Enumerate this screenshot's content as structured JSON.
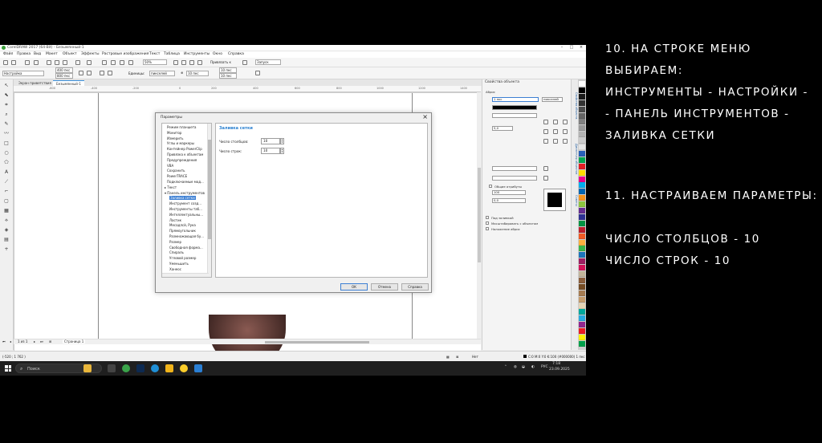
{
  "app": {
    "title": "CorelDRAW 2017 (64-Bit) - Безымянный-1",
    "menu": [
      "Файл",
      "Правка",
      "Вид",
      "Макет",
      "Объект",
      "Эффекты",
      "Растровые изображения",
      "Текст",
      "Таблица",
      "Инструменты",
      "Окно",
      "Справка"
    ],
    "std": {
      "zoom": "50%",
      "snap": "Привязать к",
      "launch": "Запуск"
    },
    "prop": {
      "preset": "Настройка",
      "w": "400 пкс",
      "h": "800 пкс",
      "units_label": "Единицы:",
      "units": "пикселей",
      "nudge": "10 пкс",
      "dup_x": "10 пкс",
      "dup_y": "10 пкс"
    },
    "tabs": [
      "Экран приветствия",
      "Безымянный-1"
    ],
    "ruler": [
      "-600",
      "-400",
      "-200",
      "0",
      "200",
      "400",
      "600",
      "800",
      "1000",
      "1200",
      "1400"
    ],
    "page_nav": {
      "counter": "1 из 1",
      "page": "Страница 1"
    },
    "status": {
      "coords": "(-520 ; 1 762 )",
      "nofill": "Нет",
      "fill_info": "C:0 M:0 Y:0 K:100 (#000000) 1 пкс"
    }
  },
  "docker": {
    "title": "Свойства объекта",
    "outline_label": "Абрис",
    "outline_width": "1 пкс",
    "units": "пикселей",
    "miter": "5,0",
    "common_attrs": "Общие атрибуты",
    "stretch": "100",
    "angle": "0,0",
    "cb1": "Под заливкой",
    "cb2": "Масштабировать с объектом",
    "cb3": "Наложение абрис",
    "vtabs": [
      "Свойства объекта",
      "Диспетчер объектов",
      "Советы"
    ]
  },
  "palette_colors": [
    "#ffffff",
    "#000000",
    "#1a1a1a",
    "#333333",
    "#4d4d4d",
    "#666666",
    "#808080",
    "#999999",
    "#b3b3b3",
    "#cccccc",
    "#e6e6e6",
    "#2860b8",
    "#00a651",
    "#e31e24",
    "#ffde00",
    "#ec008c",
    "#00aeef",
    "#0066b3",
    "#f7941d",
    "#8dc63f",
    "#662d91",
    "#2e3192",
    "#009444",
    "#be1e2d",
    "#f15a24",
    "#fbb040",
    "#39b54a",
    "#1c75bc",
    "#9e1f63",
    "#d4145a",
    "#c2b59b",
    "#8b5e3c",
    "#754c24",
    "#a67c52",
    "#c69c6d",
    "#e5d3b3",
    "#00a99d",
    "#27aae1",
    "#92278f",
    "#ed1c24",
    "#fff200",
    "#00a14b"
  ],
  "dialog": {
    "title": "Параметры",
    "tree": [
      "Режим планшета",
      "Монитор",
      "Измерить",
      "Углы и маркеры",
      "Контейнер PowerClip",
      "Привязка к объектам",
      "Предупреждения",
      "VBA",
      "Сохранить",
      "PowerTRACE",
      "Подключаемые мод...",
      "Текст",
      "Панель инструментов",
      "Заливка сетки",
      "Инструмент созд...",
      "Инструменты таб...",
      "Интеллектуальны...",
      "Ластик",
      "Месадлсй, Рука",
      "Прямоугольник",
      "Размножающая бу...",
      "Размер",
      "Свободная форма...",
      "Спираль",
      "Угловой размер",
      "Уменьшить",
      "Ханеос"
    ],
    "panel_title": "Заливка сетки",
    "cols_label": "Число столбцов:",
    "cols_value": "10",
    "rows_label": "Число строк:",
    "rows_value": "10",
    "ok": "ОК",
    "cancel": "Отмена",
    "help": "Справка"
  },
  "taskbar": {
    "search": "Поиск",
    "lang": "РУС",
    "time": "7:18",
    "date": "23.09.2025"
  },
  "instructions": {
    "step10_line1": "10. НА СТРОКЕ МЕНЮ",
    "step10_line2": "ВЫБИРАЕМ:",
    "step10_line3": "ИНСТРУМЕНТЫ - НАСТРОЙКИ -",
    "step10_line4": "- ПАНЕЛЬ ИНСТРУМЕНТОВ -",
    "step10_line5": "ЗАЛИВКА СЕТКИ",
    "step11_line1": "11. НАСТРАИВАЕМ ПАРАМЕТРЫ:",
    "step11_line2": "ЧИСЛО СТОЛБЦОВ - 10",
    "step11_line3": "ЧИСЛО СТРОК - 10"
  }
}
